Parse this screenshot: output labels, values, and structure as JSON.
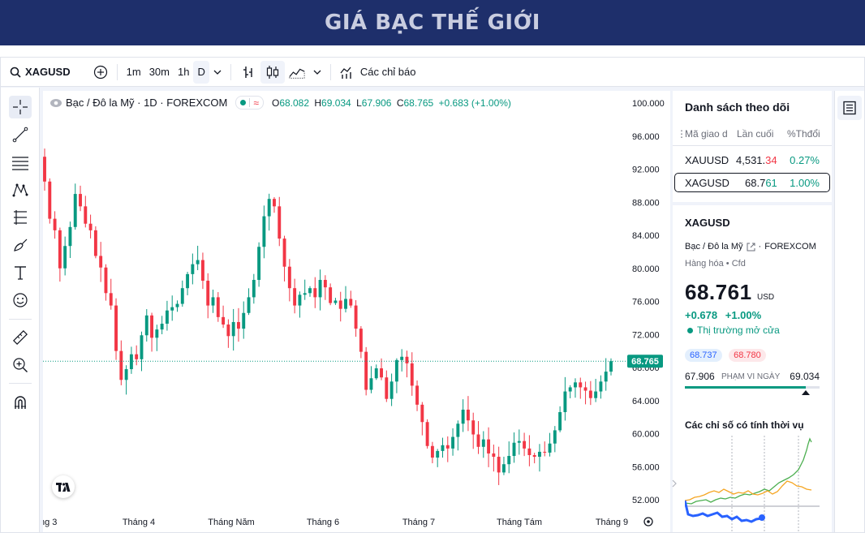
{
  "banner": {
    "title": "GIÁ BẠC THẾ GIỚI"
  },
  "toolbar": {
    "symbol": "XAGUSD",
    "intervals": [
      "1m",
      "30m",
      "1h",
      "D"
    ],
    "indicators_label": "Các chỉ báo"
  },
  "legend": {
    "name": "Bạc / Đô la Mỹ · 1D · FOREXCOM",
    "o_label": "O",
    "o": "68.082",
    "h_label": "H",
    "h": "69.034",
    "l_label": "L",
    "l": "67.906",
    "c_label": "C",
    "c": "68.765",
    "change": "+0.683 (+1.00%)"
  },
  "chart_data": {
    "type": "candlestick",
    "y_ticks": [
      "100.000",
      "96.000",
      "92.000",
      "88.000",
      "84.000",
      "80.000",
      "76.000",
      "72.000",
      "68.000",
      "64.000",
      "60.000",
      "56.000",
      "52.000"
    ],
    "ylim": [
      52,
      100
    ],
    "x_ticks": [
      "ng 3",
      "Tháng 4",
      "Tháng Năm",
      "Tháng 6",
      "Tháng 7",
      "Tháng Tám",
      "Tháng 9"
    ],
    "last_price_label": "68.765",
    "last_price": 68.765,
    "closes": [
      90.5,
      86,
      84.6,
      80,
      82.7,
      85,
      89,
      87.5,
      85.4,
      84.6,
      81.5,
      80.1,
      77,
      75.5,
      70,
      66.5,
      67.8,
      69.6,
      69,
      71.9,
      74.3,
      71.6,
      72.6,
      73.3,
      74.9,
      75.3,
      75.7,
      77.6,
      79.3,
      80.5,
      81,
      78.5,
      75.5,
      76.5,
      74.1,
      73.2,
      71.8,
      73.5,
      72.7,
      74.6,
      76.5,
      78.6,
      82.6,
      86.3,
      88.4,
      87.5,
      83.6,
      80.2,
      77.6,
      75.5,
      76.8,
      77,
      77.6,
      76.5,
      78.6,
      77.7,
      75.8,
      76.1,
      75.1,
      76.3,
      75.5,
      72.7,
      69.9,
      65.3,
      66.7,
      67.9,
      66.8,
      64.2,
      66.3,
      68.9,
      69.3,
      68.5,
      65.8,
      63.5,
      61.4,
      58.5,
      57.1,
      57.9,
      58.6,
      58.2,
      59.6,
      61.2,
      62.9,
      61.6,
      59.9,
      58.4,
      59.3,
      57.6,
      57.2,
      55.3,
      56.3,
      57.3,
      58.9,
      59.1,
      58.2,
      57.4,
      57.2,
      57.8,
      57.7,
      58.8,
      60.4,
      62.6,
      65.1,
      65.6,
      66.2,
      65.6,
      65.2,
      64.3,
      65.1,
      66.3,
      67.5,
      68.765
    ]
  },
  "watchlist": {
    "title": "Danh sách theo dõi",
    "columns": [
      "Mã giao d",
      "Lần cuối",
      "%Thđổi"
    ],
    "rows": [
      {
        "symbol": "XAUUSD",
        "last_main": "4,531.",
        "last_tail": "34",
        "change": "0.27%"
      },
      {
        "symbol": "XAGUSD",
        "last_main": "68.7",
        "last_tail": "61",
        "change": "1.00%"
      }
    ]
  },
  "details": {
    "symbol": "XAGUSD",
    "name": "Bạc / Đô la Mỹ",
    "exchange": "FOREXCOM",
    "category": "Hàng hóa",
    "type": "Cfd",
    "price": "68.761",
    "currency": "USD",
    "change_abs": "+0.678",
    "change_pct": "+1.00%",
    "market_status": "Thị trường mở cửa",
    "bid": "68.737",
    "ask": "68.780",
    "range_low": "67.906",
    "range_high": "69.034",
    "range_label": "PHẠM VI NGÀY",
    "range_position": 0.9,
    "seasonal_title": "Các chỉ số có tính thời vụ"
  },
  "colors": {
    "up": "#089981",
    "down": "#f23645",
    "banner": "#1e2f6b",
    "accent": "#2962ff"
  }
}
